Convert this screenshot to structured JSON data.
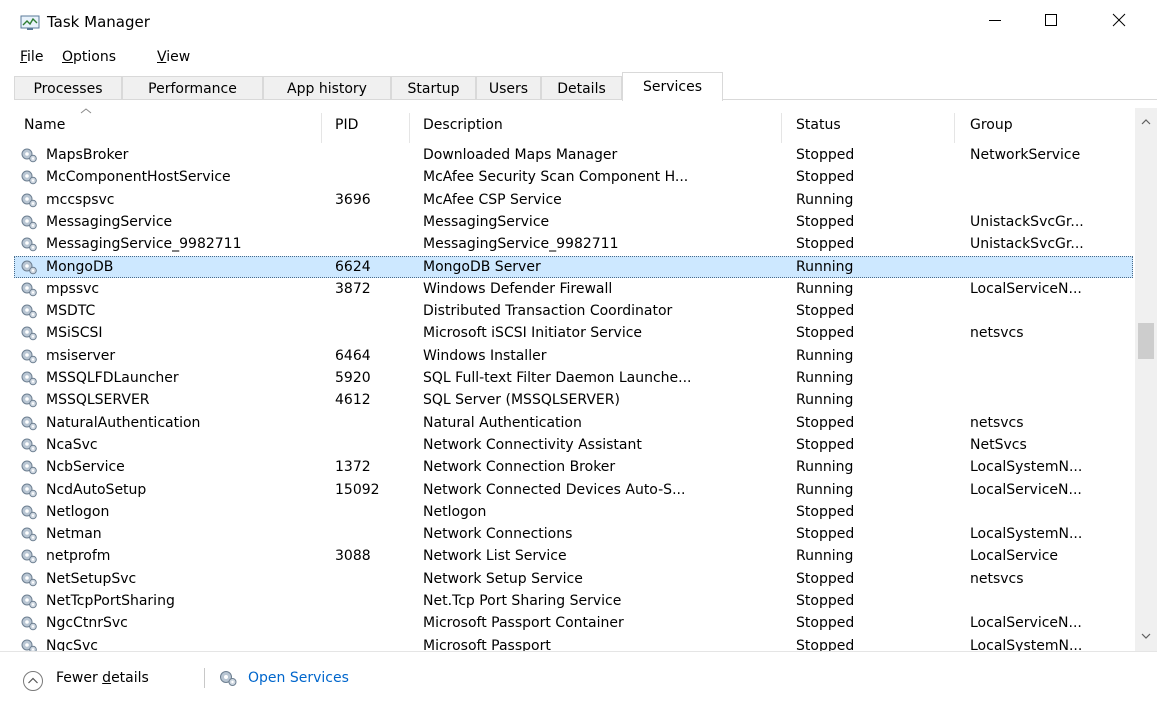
{
  "window": {
    "title": "Task Manager",
    "icons": {
      "app": "task-manager-icon",
      "minimize": "minimize-icon",
      "maximize": "maximize-icon",
      "close": "close-icon"
    }
  },
  "menu": [
    {
      "label": "File",
      "u": "F",
      "rest": "ile"
    },
    {
      "label": "Options",
      "u": "O",
      "rest": "ptions"
    },
    {
      "label": "View",
      "u": "V",
      "rest": "iew"
    }
  ],
  "tabs": [
    "Processes",
    "Performance",
    "App history",
    "Startup",
    "Users",
    "Details",
    "Services"
  ],
  "active_tab": "Services",
  "columns": [
    "Name",
    "PID",
    "Description",
    "Status",
    "Group"
  ],
  "sorted_column": "Name",
  "rows": [
    {
      "name": "MapsBroker",
      "pid": "",
      "description": "Downloaded Maps Manager",
      "status": "Stopped",
      "group": "NetworkService"
    },
    {
      "name": "McComponentHostService",
      "pid": "",
      "description": "McAfee Security Scan Component H...",
      "status": "Stopped",
      "group": ""
    },
    {
      "name": "mccspsvc",
      "pid": "3696",
      "description": "McAfee CSP Service",
      "status": "Running",
      "group": ""
    },
    {
      "name": "MessagingService",
      "pid": "",
      "description": "MessagingService",
      "status": "Stopped",
      "group": "UnistackSvcGr..."
    },
    {
      "name": "MessagingService_9982711",
      "pid": "",
      "description": "MessagingService_9982711",
      "status": "Stopped",
      "group": "UnistackSvcGr..."
    },
    {
      "name": "MongoDB",
      "pid": "6624",
      "description": "MongoDB Server",
      "status": "Running",
      "group": "",
      "selected": true
    },
    {
      "name": "mpssvc",
      "pid": "3872",
      "description": "Windows Defender Firewall",
      "status": "Running",
      "group": "LocalServiceN..."
    },
    {
      "name": "MSDTC",
      "pid": "",
      "description": "Distributed Transaction Coordinator",
      "status": "Stopped",
      "group": ""
    },
    {
      "name": "MSiSCSI",
      "pid": "",
      "description": "Microsoft iSCSI Initiator Service",
      "status": "Stopped",
      "group": "netsvcs"
    },
    {
      "name": "msiserver",
      "pid": "6464",
      "description": "Windows Installer",
      "status": "Running",
      "group": ""
    },
    {
      "name": "MSSQLFDLauncher",
      "pid": "5920",
      "description": "SQL Full-text Filter Daemon Launche...",
      "status": "Running",
      "group": ""
    },
    {
      "name": "MSSQLSERVER",
      "pid": "4612",
      "description": "SQL Server (MSSQLSERVER)",
      "status": "Running",
      "group": ""
    },
    {
      "name": "NaturalAuthentication",
      "pid": "",
      "description": "Natural Authentication",
      "status": "Stopped",
      "group": "netsvcs"
    },
    {
      "name": "NcaSvc",
      "pid": "",
      "description": "Network Connectivity Assistant",
      "status": "Stopped",
      "group": "NetSvcs"
    },
    {
      "name": "NcbService",
      "pid": "1372",
      "description": "Network Connection Broker",
      "status": "Running",
      "group": "LocalSystemN..."
    },
    {
      "name": "NcdAutoSetup",
      "pid": "15092",
      "description": "Network Connected Devices Auto-S...",
      "status": "Running",
      "group": "LocalServiceN..."
    },
    {
      "name": "Netlogon",
      "pid": "",
      "description": "Netlogon",
      "status": "Stopped",
      "group": ""
    },
    {
      "name": "Netman",
      "pid": "",
      "description": "Network Connections",
      "status": "Stopped",
      "group": "LocalSystemN..."
    },
    {
      "name": "netprofm",
      "pid": "3088",
      "description": "Network List Service",
      "status": "Running",
      "group": "LocalService"
    },
    {
      "name": "NetSetupSvc",
      "pid": "",
      "description": "Network Setup Service",
      "status": "Stopped",
      "group": "netsvcs"
    },
    {
      "name": "NetTcpPortSharing",
      "pid": "",
      "description": "Net.Tcp Port Sharing Service",
      "status": "Stopped",
      "group": ""
    },
    {
      "name": "NgcCtnrSvc",
      "pid": "",
      "description": "Microsoft Passport Container",
      "status": "Stopped",
      "group": "LocalServiceN..."
    },
    {
      "name": "NgcSvc",
      "pid": "",
      "description": "Microsoft Passport",
      "status": "Stopped",
      "group": "LocalSystemN..."
    }
  ],
  "footer": {
    "fewer_details": {
      "label": "Fewer details",
      "pre": "Fewer ",
      "u": "d",
      "rest": "etails"
    },
    "open_services": "Open Services"
  },
  "colors": {
    "selection": "#cde8ff",
    "link": "#0066cc",
    "tab_bg": "#f0f0f0",
    "border": "#d9d9d9"
  }
}
